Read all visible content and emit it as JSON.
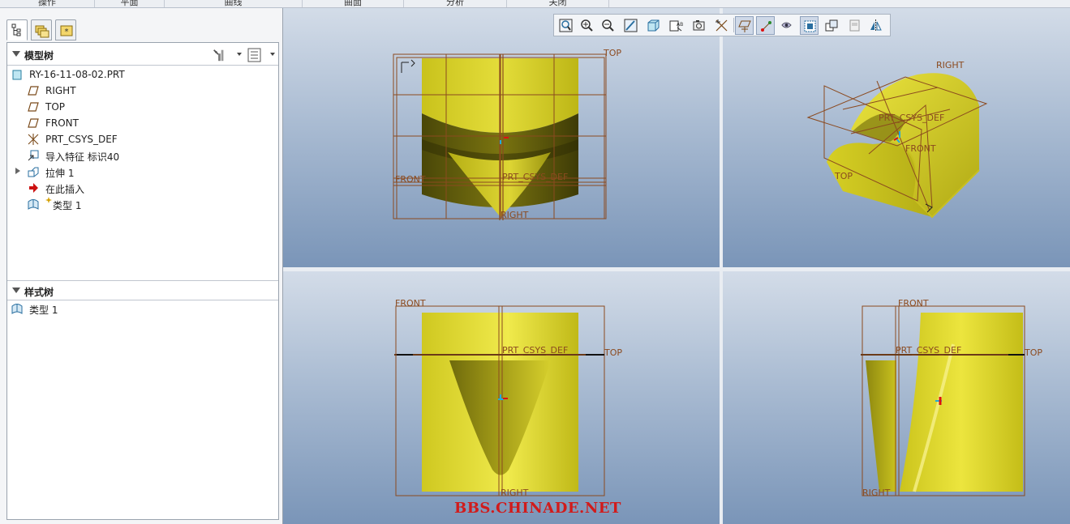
{
  "menubar": {
    "items": [
      "操作",
      "平面",
      "曲线",
      "曲面",
      "分析",
      "关闭"
    ]
  },
  "left_tabs": [
    {
      "icon": "model-tree-icon",
      "active": true
    },
    {
      "icon": "folder-browser-icon",
      "active": false
    },
    {
      "icon": "favorites-icon",
      "active": false
    }
  ],
  "model_tree": {
    "title": "模型树",
    "items": [
      {
        "label": "RY-16-11-08-02.PRT",
        "icon": "part-icon"
      },
      {
        "label": "RIGHT",
        "icon": "datum-plane-icon"
      },
      {
        "label": "TOP",
        "icon": "datum-plane-icon"
      },
      {
        "label": "FRONT",
        "icon": "datum-plane-icon"
      },
      {
        "label": "PRT_CSYS_DEF",
        "icon": "csys-icon"
      },
      {
        "label": "导入特征 标识40",
        "icon": "import-feature-icon"
      },
      {
        "label": "拉伸 1",
        "icon": "extrude-icon",
        "expandable": true
      },
      {
        "label": "在此插入",
        "icon": "insert-here-arrow-icon"
      },
      {
        "label": "类型 1",
        "icon": "style-feature-icon",
        "starred": true
      }
    ]
  },
  "style_tree": {
    "title": "样式树",
    "items": [
      {
        "label": "类型 1",
        "icon": "style-feature-icon"
      }
    ]
  },
  "viewports": {
    "tl": {
      "labels": {
        "top": "TOP",
        "front": "FRONT",
        "csys": "PRT_CSYS_DEF",
        "right": "RIGHT"
      }
    },
    "tr": {
      "labels": {
        "right": "RIGHT",
        "csys": "PRT_CSYS_DEF",
        "front": "FRONT",
        "top": "TOP"
      }
    },
    "bl": {
      "labels": {
        "front": "FRONT",
        "csys": "PRT_CSYS_DEF",
        "top": "TOP",
        "right": "RIGHT"
      }
    },
    "br": {
      "labels": {
        "front": "FRONT",
        "csys": "PRT_CSYS_DEF",
        "top": "TOP",
        "right": "RIGHT"
      }
    }
  },
  "view_toolbar": [
    "refit-icon",
    "zoom-in-icon",
    "zoom-out-icon",
    "repaint-icon",
    "display-style-icon",
    "saved-views-icon",
    "named-view-icon",
    "spin-center-icon",
    "annotation-display-icon",
    "plane-display-icon",
    "axis-display-icon",
    "point-display-icon",
    "csys-display-icon",
    "style-plane-icon",
    "next-view-icon",
    "layout-icon",
    "mirror-icon"
  ],
  "colors": {
    "model_yellow": "#d8d226",
    "datum_brown": "#8b4a1f",
    "watermark_red": "#d11b1b"
  },
  "watermark": "BBS.CHINADE.NET"
}
